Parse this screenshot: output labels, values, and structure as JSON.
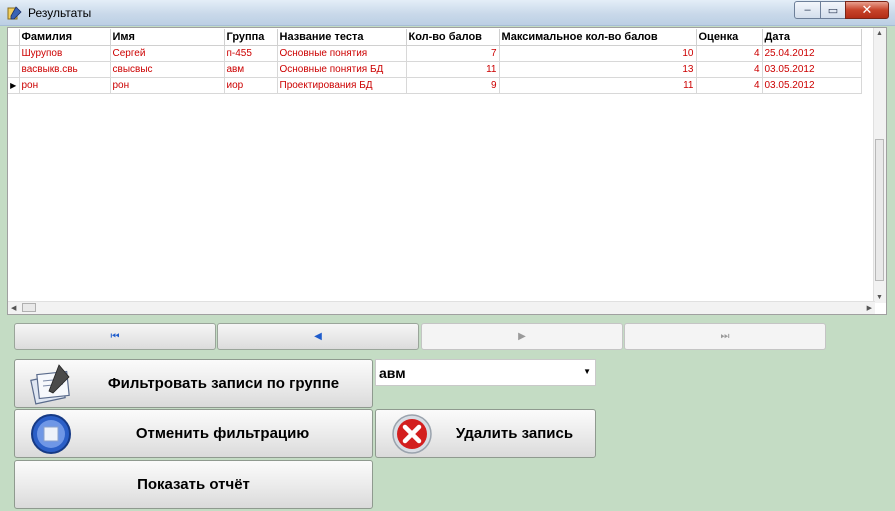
{
  "window": {
    "title": "Результаты",
    "minimize": "‒",
    "maximize": "▭",
    "close": "✕"
  },
  "grid": {
    "columns": [
      "Фамилия",
      "Имя",
      "Группа",
      "Название теста",
      "Кол-во балов",
      "Максимальное кол-во балов",
      "Оценка",
      "Дата"
    ],
    "row_indicator": "▶",
    "rows": [
      [
        "Шурупов",
        "Сергей",
        "п-455",
        "Основные понятия",
        "7",
        "10",
        "4",
        "25.04.2012"
      ],
      [
        "васвыкв.свь",
        "свысвыс",
        "авм",
        "Основные понятия БД",
        "11",
        "13",
        "4",
        "03.05.2012"
      ],
      [
        "рон",
        "рон",
        "иор",
        "Проектирования БД",
        "9",
        "11",
        "4",
        "03.05.2012"
      ]
    ]
  },
  "navigator": {
    "first": "⏮",
    "prior": "◀",
    "next": "▶",
    "last": "⏭"
  },
  "buttons": {
    "filter": "Фильтровать записи по группе",
    "cancel_filter": "Отменить фильтрацию",
    "delete": "Удалить запись",
    "report": "Показать отчёт"
  },
  "group_combo": {
    "value": "авм"
  }
}
